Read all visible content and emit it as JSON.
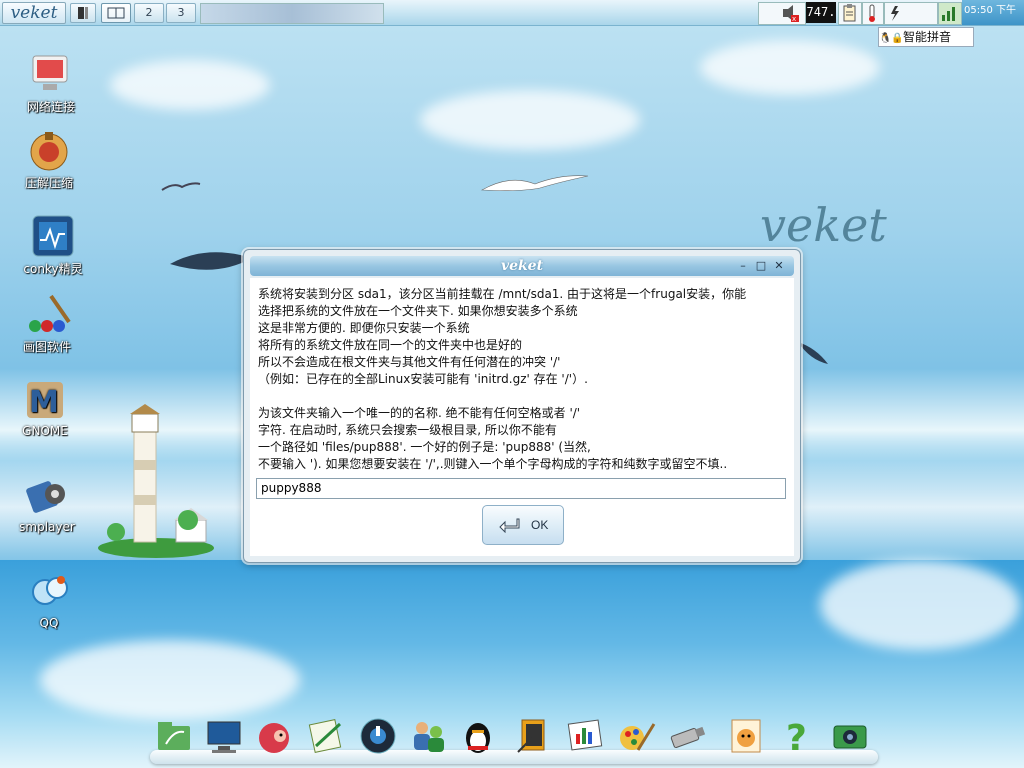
{
  "taskbar": {
    "logo": "veket",
    "workspaces": [
      "2",
      "3"
    ],
    "counter": "747.",
    "clock": "05:50 下午"
  },
  "ime": {
    "label": "智能拼音"
  },
  "desktop_icons": [
    {
      "id": "network",
      "label": "网络连接"
    },
    {
      "id": "archive",
      "label": "压解压缩"
    },
    {
      "id": "conky",
      "label": "conky精灵"
    },
    {
      "id": "paint",
      "label": "画图软件"
    },
    {
      "id": "gnome",
      "label": "GNOME"
    },
    {
      "id": "smplayer",
      "label": "smplayer"
    },
    {
      "id": "qq",
      "label": "QQ"
    }
  ],
  "wallpaper": {
    "watermark": "veket"
  },
  "dialog": {
    "title": "veket",
    "message": "系统将安装到分区 sda1，该分区当前挂载在 /mnt/sda1. 由于这将是一个frugal安装，你能\n选择把系统的文件放在一个文件夹下. 如果你想安装多个系统\n这是非常方便的. 即便你只安装一个系统\n将所有的系统文件放在同一个的文件夹中也是好的\n所以不会造成在根文件夹与其他文件有任何潜在的冲突 '/'\n（例如：已存在的全部Linux安装可能有 'initrd.gz' 存在 '/'）.\n\n为该文件夹输入一个唯一的的名称. 绝不能有任何空格或者 '/'\n字符. 在启动时, 系统只会搜索一级根目录, 所以你不能有\n一个路径如 'files/pup888'. 一个好的例子是: 'pup888' (当然,\n不要输入 '). 如果您想要安装在 '/',.则键入一个单个字母构成的字符和纯数字或留空不填..",
    "input_value": "puppy888",
    "ok_label": "OK"
  },
  "colors": {
    "accent": "#7fb4d6",
    "dialog_bg": "#e6eef3"
  }
}
